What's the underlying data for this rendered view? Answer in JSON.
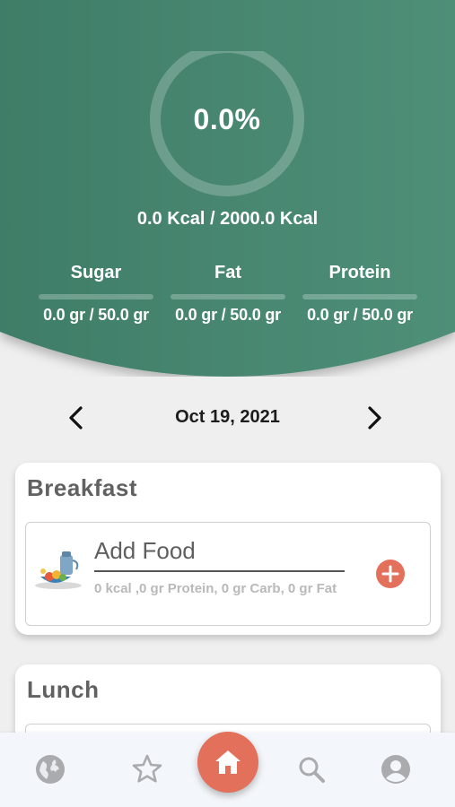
{
  "summary": {
    "progress_percent_text": "0.0%",
    "progress_fraction": 0.0,
    "kcal_text": "0.0 Kcal / 2000.0 Kcal"
  },
  "macros": [
    {
      "label": "Sugar",
      "value": "0.0 gr / 50.0 gr",
      "fraction": 0.0
    },
    {
      "label": "Fat",
      "value": "0.0 gr / 50.0 gr",
      "fraction": 0.0
    },
    {
      "label": "Protein",
      "value": "0.0 gr / 50.0 gr",
      "fraction": 0.0
    }
  ],
  "date_nav": {
    "date": "Oct 19, 2021",
    "prev_icon": "chevron-left-icon",
    "next_icon": "chevron-right-icon"
  },
  "meals": [
    {
      "title": "Breakfast",
      "add_food_label": "Add Food",
      "info": "0 kcal ,0 gr Protein, 0 gr Carb, 0 gr Fat"
    },
    {
      "title": "Lunch"
    }
  ],
  "bottom_nav": {
    "items": [
      "globe-icon",
      "star-icon",
      "home-icon",
      "search-icon",
      "profile-icon"
    ]
  },
  "colors": {
    "header_green": "#4a8a73",
    "accent_orange": "#e2705a",
    "background": "#efefef"
  }
}
